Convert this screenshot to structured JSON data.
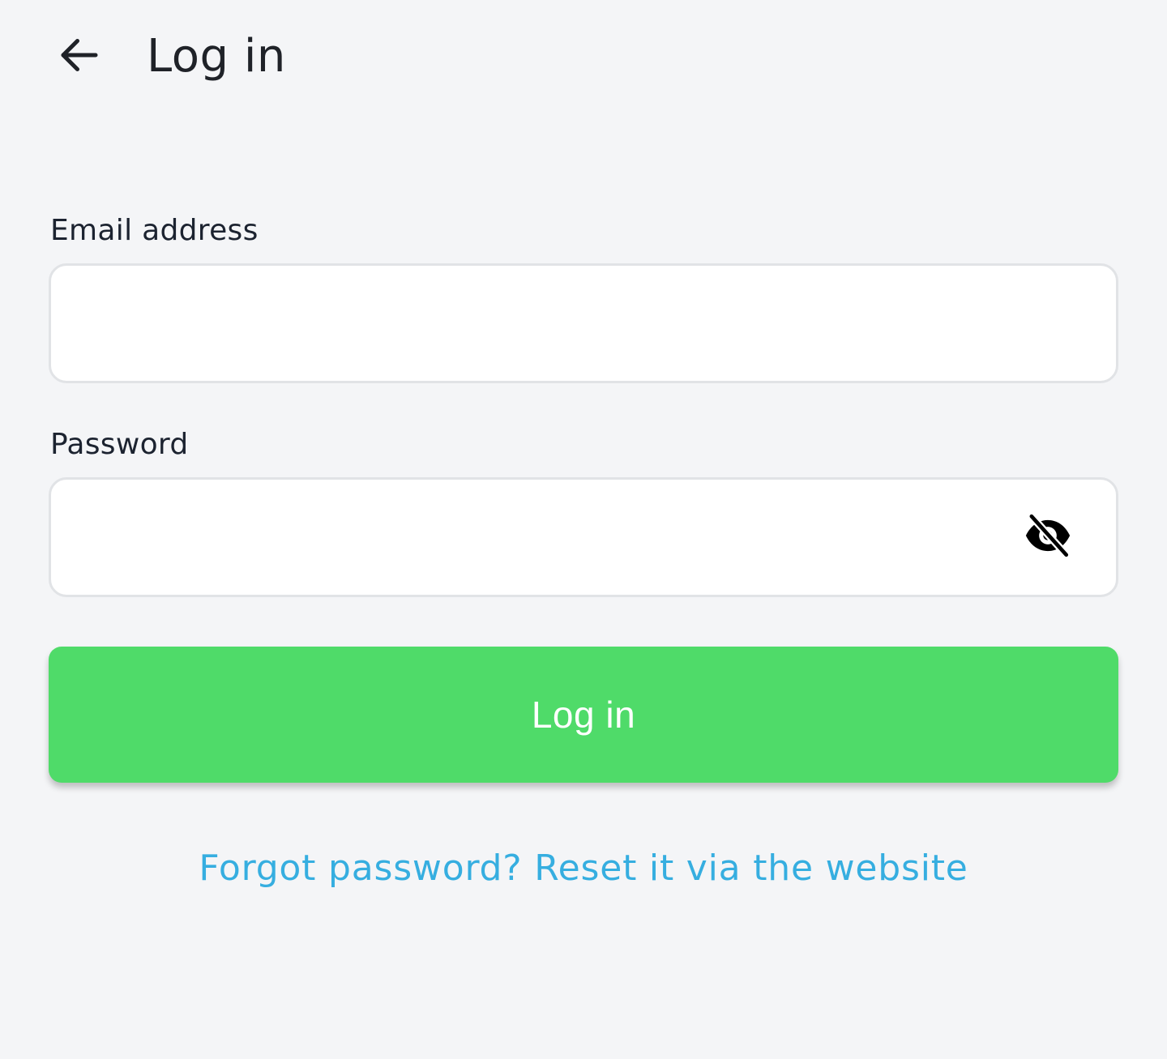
{
  "header": {
    "back_icon": "arrow-left-icon",
    "title": "Log in"
  },
  "form": {
    "email": {
      "label": "Email address",
      "value": "",
      "placeholder": ""
    },
    "password": {
      "label": "Password",
      "value": "",
      "placeholder": "",
      "visibility_icon": "eye-off-icon"
    },
    "submit_label": "Log in",
    "forgot_link": "Forgot password? Reset it via the website"
  },
  "colors": {
    "background": "#f4f5f7",
    "primary_button": "#4fdb69",
    "link": "#36aee0",
    "text": "#1c2330",
    "field_border": "#e1e3e6"
  }
}
